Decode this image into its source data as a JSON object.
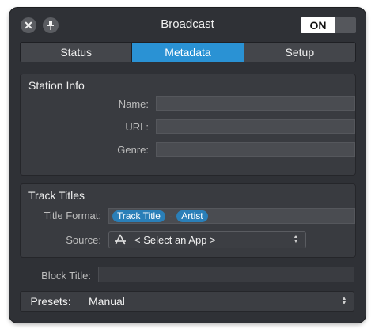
{
  "window": {
    "title": "Broadcast",
    "toggle_label": "ON",
    "close_icon": "close-icon",
    "pin_icon": "pin-icon"
  },
  "tabs": [
    {
      "label": "Status",
      "active": false
    },
    {
      "label": "Metadata",
      "active": true
    },
    {
      "label": "Setup",
      "active": false
    }
  ],
  "station_info": {
    "title": "Station Info",
    "name_label": "Name:",
    "name_value": "",
    "url_label": "URL:",
    "url_value": "",
    "genre_label": "Genre:",
    "genre_value": ""
  },
  "track_titles": {
    "title": "Track Titles",
    "format_label": "Title Format:",
    "format_tokens": [
      "Track Title",
      "Artist"
    ],
    "format_separator": "-",
    "source_label": "Source:",
    "source_value": "< Select an App >",
    "source_icon": "app-store-icon"
  },
  "block_title": {
    "label": "Block Title:",
    "value": ""
  },
  "presets": {
    "label": "Presets:",
    "value": "Manual"
  },
  "colors": {
    "accent": "#2a92d4",
    "token": "#2a7fb8",
    "window_bg": "#2f3136",
    "panel_bg": "#393b40"
  }
}
